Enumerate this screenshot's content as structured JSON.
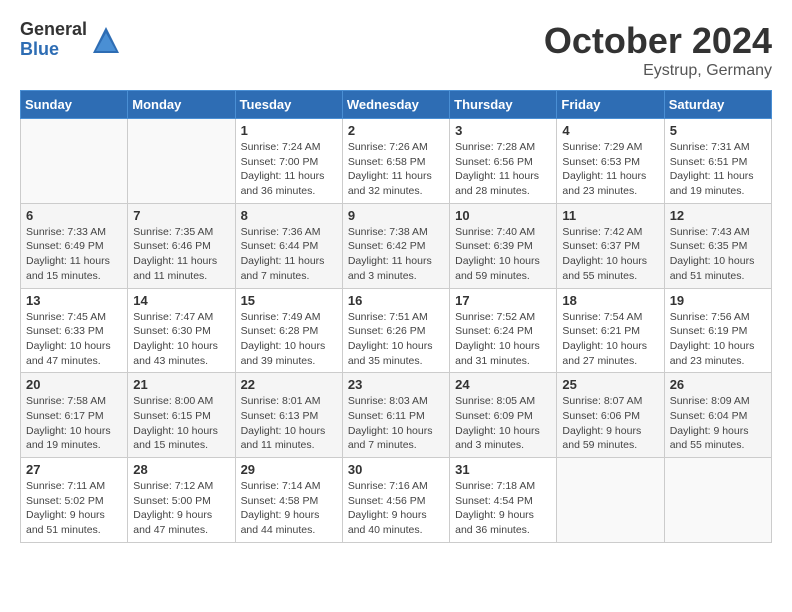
{
  "header": {
    "logo_general": "General",
    "logo_blue": "Blue",
    "month_year": "October 2024",
    "location": "Eystrup, Germany"
  },
  "weekdays": [
    "Sunday",
    "Monday",
    "Tuesday",
    "Wednesday",
    "Thursday",
    "Friday",
    "Saturday"
  ],
  "weeks": [
    [
      {
        "day": "",
        "sunrise": "",
        "sunset": "",
        "daylight": ""
      },
      {
        "day": "",
        "sunrise": "",
        "sunset": "",
        "daylight": ""
      },
      {
        "day": "1",
        "sunrise": "Sunrise: 7:24 AM",
        "sunset": "Sunset: 7:00 PM",
        "daylight": "Daylight: 11 hours and 36 minutes."
      },
      {
        "day": "2",
        "sunrise": "Sunrise: 7:26 AM",
        "sunset": "Sunset: 6:58 PM",
        "daylight": "Daylight: 11 hours and 32 minutes."
      },
      {
        "day": "3",
        "sunrise": "Sunrise: 7:28 AM",
        "sunset": "Sunset: 6:56 PM",
        "daylight": "Daylight: 11 hours and 28 minutes."
      },
      {
        "day": "4",
        "sunrise": "Sunrise: 7:29 AM",
        "sunset": "Sunset: 6:53 PM",
        "daylight": "Daylight: 11 hours and 23 minutes."
      },
      {
        "day": "5",
        "sunrise": "Sunrise: 7:31 AM",
        "sunset": "Sunset: 6:51 PM",
        "daylight": "Daylight: 11 hours and 19 minutes."
      }
    ],
    [
      {
        "day": "6",
        "sunrise": "Sunrise: 7:33 AM",
        "sunset": "Sunset: 6:49 PM",
        "daylight": "Daylight: 11 hours and 15 minutes."
      },
      {
        "day": "7",
        "sunrise": "Sunrise: 7:35 AM",
        "sunset": "Sunset: 6:46 PM",
        "daylight": "Daylight: 11 hours and 11 minutes."
      },
      {
        "day": "8",
        "sunrise": "Sunrise: 7:36 AM",
        "sunset": "Sunset: 6:44 PM",
        "daylight": "Daylight: 11 hours and 7 minutes."
      },
      {
        "day": "9",
        "sunrise": "Sunrise: 7:38 AM",
        "sunset": "Sunset: 6:42 PM",
        "daylight": "Daylight: 11 hours and 3 minutes."
      },
      {
        "day": "10",
        "sunrise": "Sunrise: 7:40 AM",
        "sunset": "Sunset: 6:39 PM",
        "daylight": "Daylight: 10 hours and 59 minutes."
      },
      {
        "day": "11",
        "sunrise": "Sunrise: 7:42 AM",
        "sunset": "Sunset: 6:37 PM",
        "daylight": "Daylight: 10 hours and 55 minutes."
      },
      {
        "day": "12",
        "sunrise": "Sunrise: 7:43 AM",
        "sunset": "Sunset: 6:35 PM",
        "daylight": "Daylight: 10 hours and 51 minutes."
      }
    ],
    [
      {
        "day": "13",
        "sunrise": "Sunrise: 7:45 AM",
        "sunset": "Sunset: 6:33 PM",
        "daylight": "Daylight: 10 hours and 47 minutes."
      },
      {
        "day": "14",
        "sunrise": "Sunrise: 7:47 AM",
        "sunset": "Sunset: 6:30 PM",
        "daylight": "Daylight: 10 hours and 43 minutes."
      },
      {
        "day": "15",
        "sunrise": "Sunrise: 7:49 AM",
        "sunset": "Sunset: 6:28 PM",
        "daylight": "Daylight: 10 hours and 39 minutes."
      },
      {
        "day": "16",
        "sunrise": "Sunrise: 7:51 AM",
        "sunset": "Sunset: 6:26 PM",
        "daylight": "Daylight: 10 hours and 35 minutes."
      },
      {
        "day": "17",
        "sunrise": "Sunrise: 7:52 AM",
        "sunset": "Sunset: 6:24 PM",
        "daylight": "Daylight: 10 hours and 31 minutes."
      },
      {
        "day": "18",
        "sunrise": "Sunrise: 7:54 AM",
        "sunset": "Sunset: 6:21 PM",
        "daylight": "Daylight: 10 hours and 27 minutes."
      },
      {
        "day": "19",
        "sunrise": "Sunrise: 7:56 AM",
        "sunset": "Sunset: 6:19 PM",
        "daylight": "Daylight: 10 hours and 23 minutes."
      }
    ],
    [
      {
        "day": "20",
        "sunrise": "Sunrise: 7:58 AM",
        "sunset": "Sunset: 6:17 PM",
        "daylight": "Daylight: 10 hours and 19 minutes."
      },
      {
        "day": "21",
        "sunrise": "Sunrise: 8:00 AM",
        "sunset": "Sunset: 6:15 PM",
        "daylight": "Daylight: 10 hours and 15 minutes."
      },
      {
        "day": "22",
        "sunrise": "Sunrise: 8:01 AM",
        "sunset": "Sunset: 6:13 PM",
        "daylight": "Daylight: 10 hours and 11 minutes."
      },
      {
        "day": "23",
        "sunrise": "Sunrise: 8:03 AM",
        "sunset": "Sunset: 6:11 PM",
        "daylight": "Daylight: 10 hours and 7 minutes."
      },
      {
        "day": "24",
        "sunrise": "Sunrise: 8:05 AM",
        "sunset": "Sunset: 6:09 PM",
        "daylight": "Daylight: 10 hours and 3 minutes."
      },
      {
        "day": "25",
        "sunrise": "Sunrise: 8:07 AM",
        "sunset": "Sunset: 6:06 PM",
        "daylight": "Daylight: 9 hours and 59 minutes."
      },
      {
        "day": "26",
        "sunrise": "Sunrise: 8:09 AM",
        "sunset": "Sunset: 6:04 PM",
        "daylight": "Daylight: 9 hours and 55 minutes."
      }
    ],
    [
      {
        "day": "27",
        "sunrise": "Sunrise: 7:11 AM",
        "sunset": "Sunset: 5:02 PM",
        "daylight": "Daylight: 9 hours and 51 minutes."
      },
      {
        "day": "28",
        "sunrise": "Sunrise: 7:12 AM",
        "sunset": "Sunset: 5:00 PM",
        "daylight": "Daylight: 9 hours and 47 minutes."
      },
      {
        "day": "29",
        "sunrise": "Sunrise: 7:14 AM",
        "sunset": "Sunset: 4:58 PM",
        "daylight": "Daylight: 9 hours and 44 minutes."
      },
      {
        "day": "30",
        "sunrise": "Sunrise: 7:16 AM",
        "sunset": "Sunset: 4:56 PM",
        "daylight": "Daylight: 9 hours and 40 minutes."
      },
      {
        "day": "31",
        "sunrise": "Sunrise: 7:18 AM",
        "sunset": "Sunset: 4:54 PM",
        "daylight": "Daylight: 9 hours and 36 minutes."
      },
      {
        "day": "",
        "sunrise": "",
        "sunset": "",
        "daylight": ""
      },
      {
        "day": "",
        "sunrise": "",
        "sunset": "",
        "daylight": ""
      }
    ]
  ]
}
